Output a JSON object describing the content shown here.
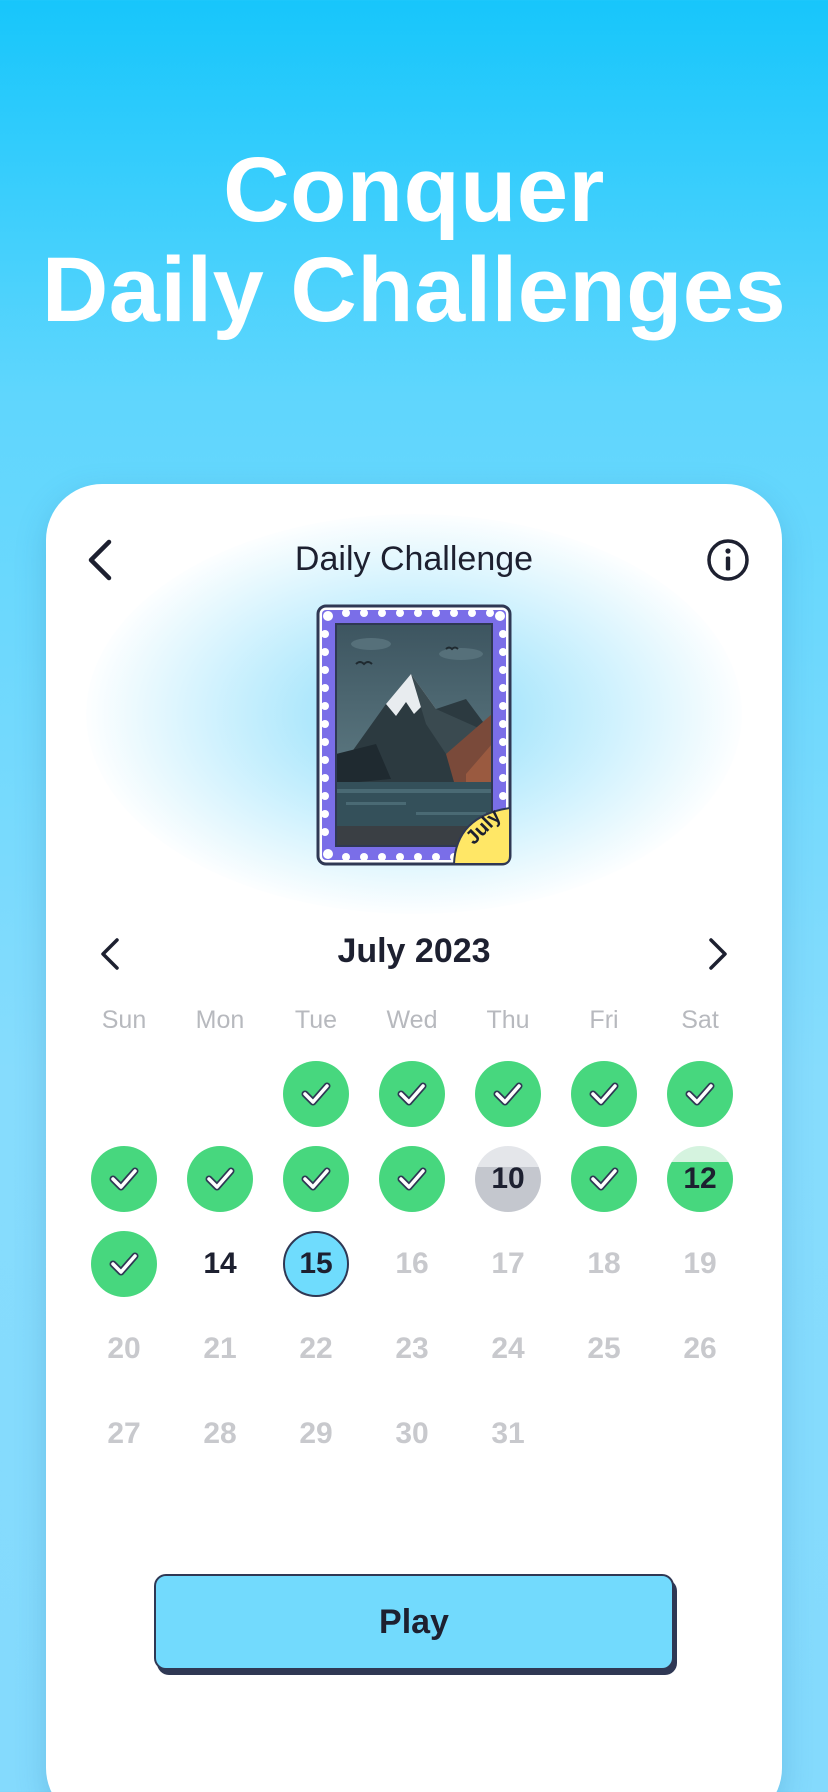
{
  "headline": {
    "line1": "Conquer",
    "line2": "Daily Challenges"
  },
  "header": {
    "title": "Daily Challenge"
  },
  "stamp": {
    "badge": "July"
  },
  "calendar": {
    "month_label": "July 2023",
    "weekdays": [
      "Sun",
      "Mon",
      "Tue",
      "Wed",
      "Thu",
      "Fri",
      "Sat"
    ],
    "weeks": [
      [
        {
          "label": "",
          "status": "empty"
        },
        {
          "label": "",
          "status": "empty"
        },
        {
          "label": "",
          "status": "done"
        },
        {
          "label": "",
          "status": "done"
        },
        {
          "label": "",
          "status": "done"
        },
        {
          "label": "",
          "status": "done"
        },
        {
          "label": "",
          "status": "done"
        }
      ],
      [
        {
          "label": "",
          "status": "done"
        },
        {
          "label": "",
          "status": "done"
        },
        {
          "label": "",
          "status": "done"
        },
        {
          "label": "",
          "status": "done"
        },
        {
          "label": "10",
          "status": "partial-grey"
        },
        {
          "label": "",
          "status": "done"
        },
        {
          "label": "12",
          "status": "partial-green"
        }
      ],
      [
        {
          "label": "",
          "status": "done"
        },
        {
          "label": "14",
          "status": "avail"
        },
        {
          "label": "15",
          "status": "today"
        },
        {
          "label": "16",
          "status": "future"
        },
        {
          "label": "17",
          "status": "future"
        },
        {
          "label": "18",
          "status": "future"
        },
        {
          "label": "19",
          "status": "future"
        }
      ],
      [
        {
          "label": "20",
          "status": "future"
        },
        {
          "label": "21",
          "status": "future"
        },
        {
          "label": "22",
          "status": "future"
        },
        {
          "label": "23",
          "status": "future"
        },
        {
          "label": "24",
          "status": "future"
        },
        {
          "label": "25",
          "status": "future"
        },
        {
          "label": "26",
          "status": "future"
        }
      ],
      [
        {
          "label": "27",
          "status": "future"
        },
        {
          "label": "28",
          "status": "future"
        },
        {
          "label": "29",
          "status": "future"
        },
        {
          "label": "30",
          "status": "future"
        },
        {
          "label": "31",
          "status": "future"
        },
        {
          "label": "",
          "status": "empty"
        },
        {
          "label": "",
          "status": "empty"
        }
      ]
    ]
  },
  "play_button": {
    "label": "Play"
  },
  "colors": {
    "done": "#47d77e",
    "today": "#6fdcfd",
    "future_text": "#c8c9cd",
    "primary_text": "#1d2030",
    "button": "#72dafd",
    "outline": "#2f3854"
  },
  "icons": {
    "back": "chevron-left-icon",
    "info": "info-icon",
    "prev_month": "chevron-left-icon",
    "next_month": "chevron-right-icon",
    "done": "check-icon"
  }
}
